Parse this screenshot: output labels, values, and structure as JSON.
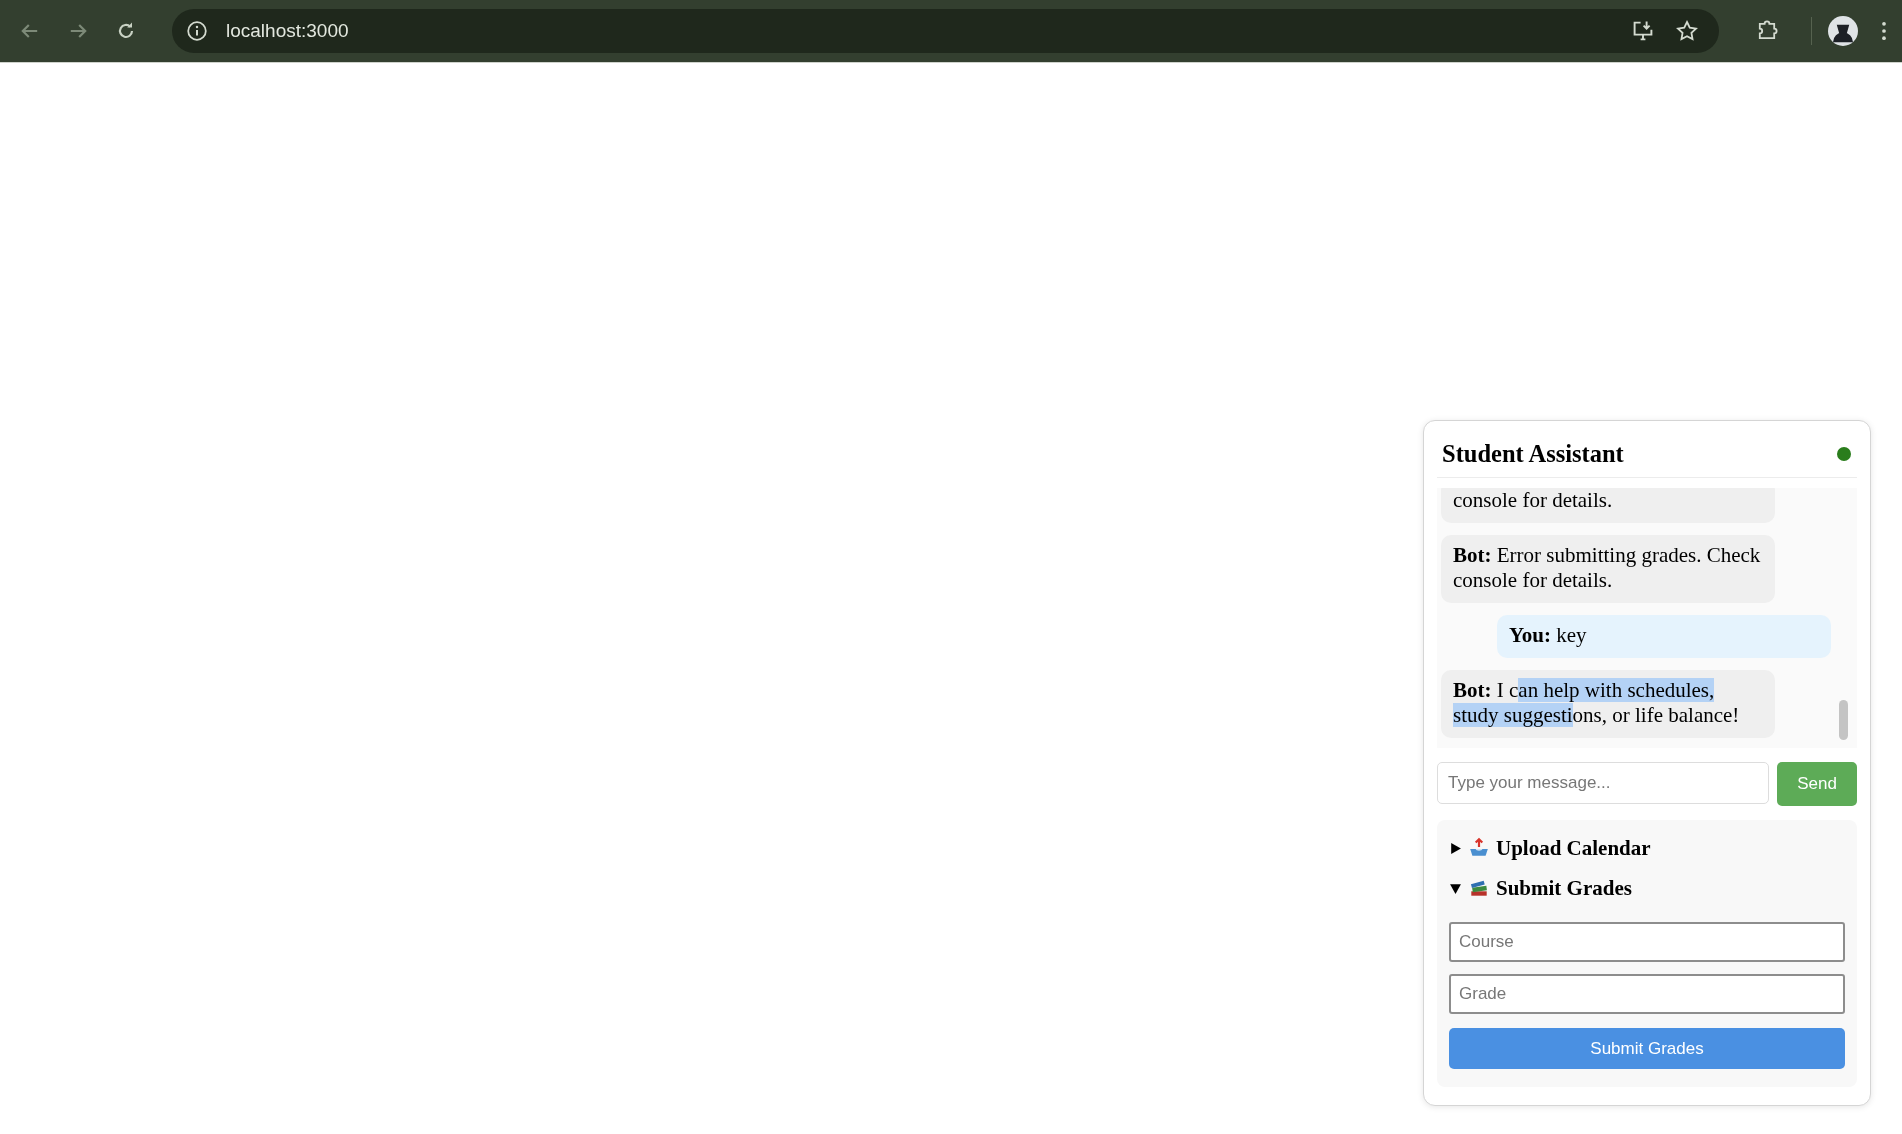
{
  "browser": {
    "url": "localhost:3000"
  },
  "chat": {
    "title": "Student Assistant",
    "online": true,
    "messages": [
      {
        "kind": "bot",
        "segments": [
          {
            "text": "console for details.",
            "selected": false
          }
        ]
      },
      {
        "kind": "bot",
        "sender": "Bot:",
        "segments": [
          {
            "text": "Error submitting grades. Check console for details.",
            "selected": false
          }
        ]
      },
      {
        "kind": "user",
        "sender": "You:",
        "segments": [
          {
            "text": "key",
            "selected": false
          }
        ]
      },
      {
        "kind": "bot",
        "sender": "Bot:",
        "segments": [
          {
            "text": "I c",
            "selected": false
          },
          {
            "text": "an help with schedules, study suggesti",
            "selected": true
          },
          {
            "text": "ons, or life balance!",
            "selected": false
          }
        ]
      }
    ],
    "input": {
      "placeholder": "Type your message..."
    },
    "send": "Send",
    "sections": [
      {
        "kind": "upload",
        "title": "Upload Calendar",
        "expanded": false
      },
      {
        "kind": "grades",
        "title": "Submit Grades",
        "expanded": true,
        "fields": [
          {
            "placeholder": "Course"
          },
          {
            "placeholder": "Grade"
          }
        ],
        "button": "Submit Grades"
      }
    ]
  }
}
